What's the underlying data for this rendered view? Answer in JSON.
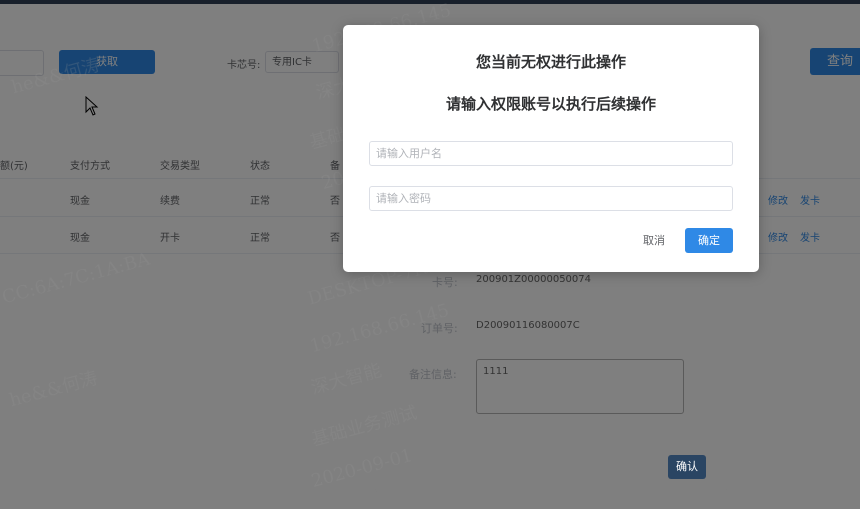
{
  "search": {
    "fetch_button": "获取",
    "chip_label": "卡芯号:",
    "chip_select_value": "专用IC卡",
    "query_button": "查询"
  },
  "table": {
    "headers": [
      "额(元)",
      "支付方式",
      "交易类型",
      "状态",
      "备"
    ],
    "rows": [
      {
        "payment": "现金",
        "type": "续费",
        "status": "正常",
        "flag": "否",
        "edit": "修改",
        "issue": "发卡"
      },
      {
        "payment": "现金",
        "type": "开卡",
        "status": "正常",
        "flag": "否",
        "edit": "修改",
        "issue": "发卡"
      }
    ]
  },
  "panel": {
    "card_label": "卡号:",
    "card_value": "200901Z00000050074",
    "order_label": "订单号:",
    "order_value": "D20090116080007C",
    "remark_label": "备注信息:",
    "remark_value": "1111",
    "confirm_button": "确认"
  },
  "dialog": {
    "title": "您当前无权进行此操作",
    "subtitle": "请输入权限账号以执行后续操作",
    "username_placeholder": "请输入用户名",
    "password_placeholder": "请输入密码",
    "cancel_button": "取消",
    "ok_button": "确定"
  },
  "watermark": {
    "ip": "192.168.66.145",
    "user": "he&&何涛",
    "company": "深大智能",
    "dept": "基础业务测试",
    "date": "2020-09-01",
    "host": "DESKTOP-7R1VH30",
    "mac": "CC:6A:7C:1A:BA"
  },
  "colors": {
    "primary": "#2f89e6",
    "mask": "rgba(0,0,0,0.5)"
  }
}
